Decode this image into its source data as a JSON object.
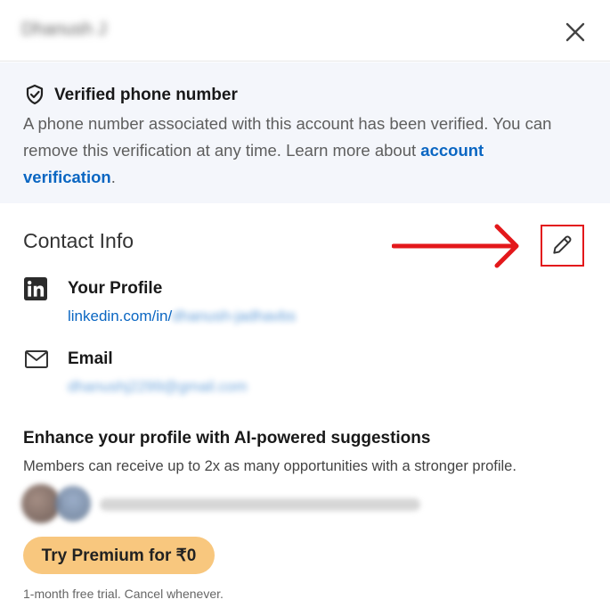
{
  "header": {
    "user_name": "Dhanush J"
  },
  "verification": {
    "title": "Verified phone number",
    "description": "A phone number associated with this account has been verified. You can remove this verification at any time. Learn more about ",
    "link_text": "account verification",
    "trailing": "."
  },
  "contact": {
    "title": "Contact Info",
    "profile_label": "Your Profile",
    "profile_prefix": "linkedin.com/in/",
    "profile_slug": "dhanush-jadhavbs",
    "email_label": "Email",
    "email_value": "dhanushj2299@gmail.com"
  },
  "enhance": {
    "title": "Enhance your profile with AI-powered suggestions",
    "description": "Members can receive up to 2x as many opportunities with a stronger profile."
  },
  "premium": {
    "button_label": "Try Premium for ₹0",
    "trial_note": "1-month free trial. Cancel whenever."
  },
  "icons": {
    "close": "close-icon",
    "verified": "shield-check-icon",
    "edit": "pencil-icon",
    "linkedin": "linkedin-icon",
    "email": "envelope-icon",
    "annotation": "red-arrow"
  },
  "colors": {
    "link": "#0a66c2",
    "banner_bg": "#f4f6fb",
    "premium_button": "#f8c77e",
    "annotation_red": "#e3181b"
  }
}
